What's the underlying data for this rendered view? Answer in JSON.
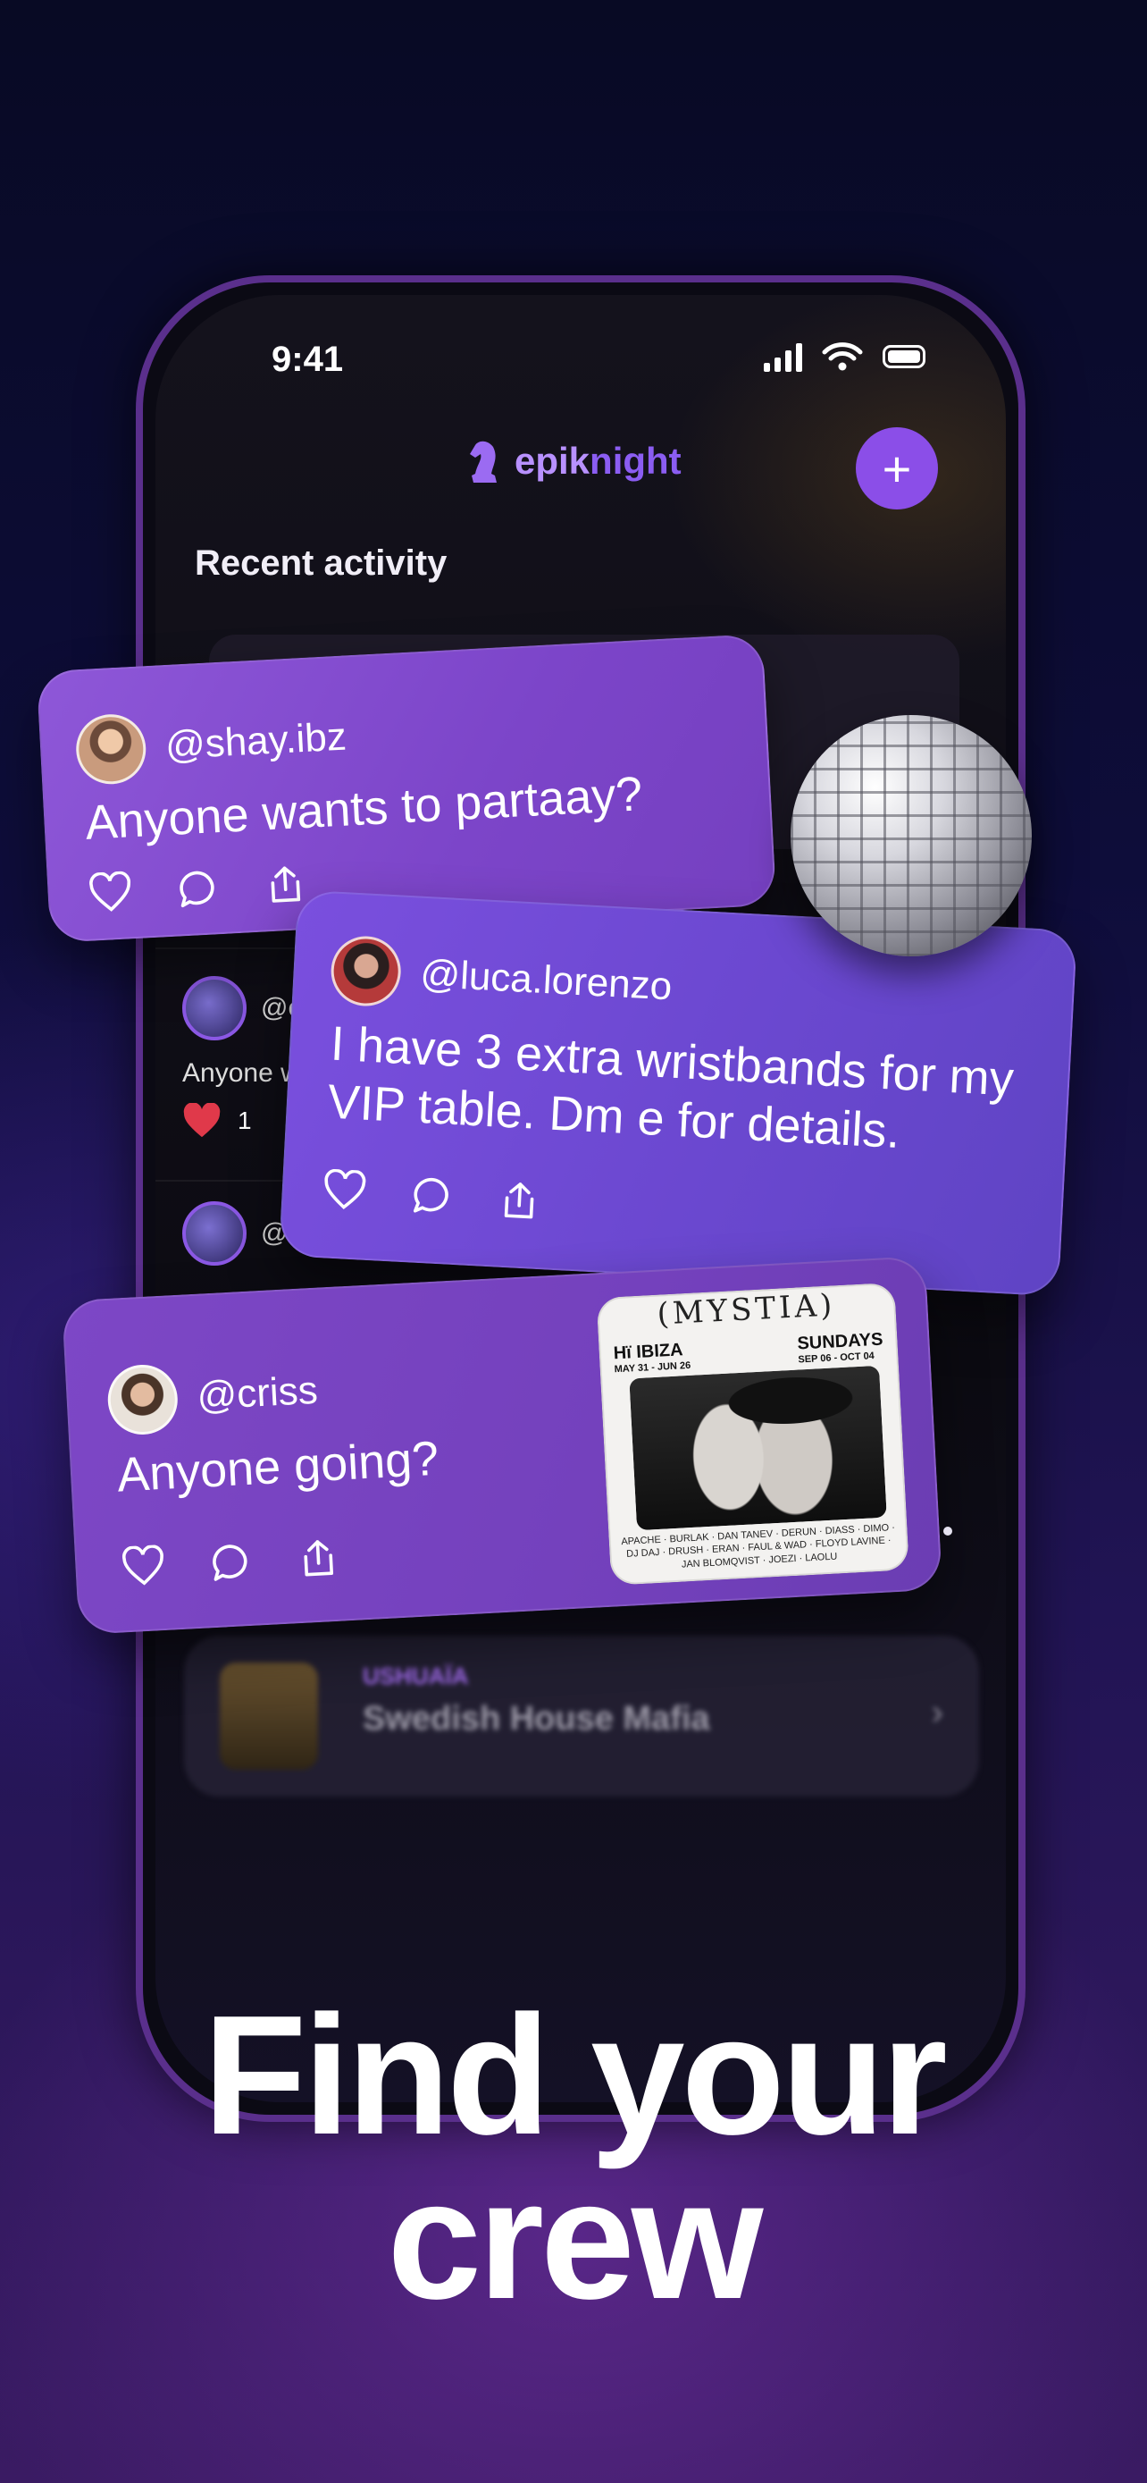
{
  "status_bar": {
    "time": "9:41"
  },
  "app": {
    "logo_part1": "epik",
    "logo_part2": "night"
  },
  "section_title": "Recent activity",
  "background_feed": {
    "post1": {
      "handle": "@epi",
      "text": "Anyone w",
      "likes": "1"
    },
    "post2": {
      "handle": "@the"
    },
    "event_card": {
      "tag": "USHUAÏA",
      "title": "Swedish House Mafia"
    }
  },
  "posts": [
    {
      "handle": "@shay.ibz",
      "message": "Anyone wants to partaay?"
    },
    {
      "handle": "@luca.lorenzo",
      "message": "I have 3 extra wristbands for my VIP table. Dm e for details."
    },
    {
      "handle": "@criss",
      "message": "Anyone going?"
    }
  ],
  "poster": {
    "title": "(MYSTIA)",
    "venue": "Hï IBIZA",
    "venue_dates": "MAY 31 - JUN 26",
    "day": "SUNDAYS",
    "day_dates": "SEP 06 - OCT 04",
    "lineup": "APACHE · BURLAK · DAN TANEV · DERUN · DIASS · DIMO · DJ DAJ · DRUSH · ERAN · FAUL & WAD · FLOYD LAVINE · JAN BLOMQVIST · JOEZI · LAOLU"
  },
  "hero": {
    "line1": "Find your",
    "line2": "crew"
  },
  "colors": {
    "accent": "#8b4ee8",
    "card": "#7c45c9",
    "background": "#0e0d3a"
  },
  "icons": [
    "heart-icon",
    "comment-icon",
    "share-icon",
    "plus-icon",
    "signal-icon",
    "wifi-icon",
    "battery-icon"
  ]
}
